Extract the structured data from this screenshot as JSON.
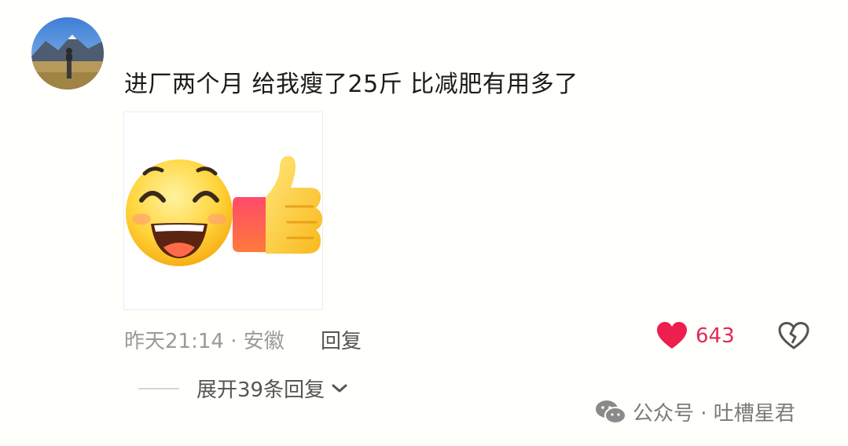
{
  "comment": {
    "avatar_icon": "user-avatar-mountain-photo",
    "text": "进厂两个月 给我瘦了25斤 比减肥有用多了",
    "sticker_icon": "laughing-face-thumbs-up-emoji",
    "meta": "昨天21:14 · 安徽",
    "reply_label": "回复",
    "like_icon": "heart-icon",
    "like_count": "643",
    "dislike_icon": "broken-heart-icon",
    "expand_label": "展开39条回复",
    "expand_icon": "chevron-down-icon"
  },
  "watermark": {
    "icon": "wechat-icon",
    "text": "公众号 · 吐槽星君"
  },
  "colors": {
    "background": "#fffffb",
    "like_red": "#e02a55",
    "meta_gray": "#9a9a9a"
  }
}
